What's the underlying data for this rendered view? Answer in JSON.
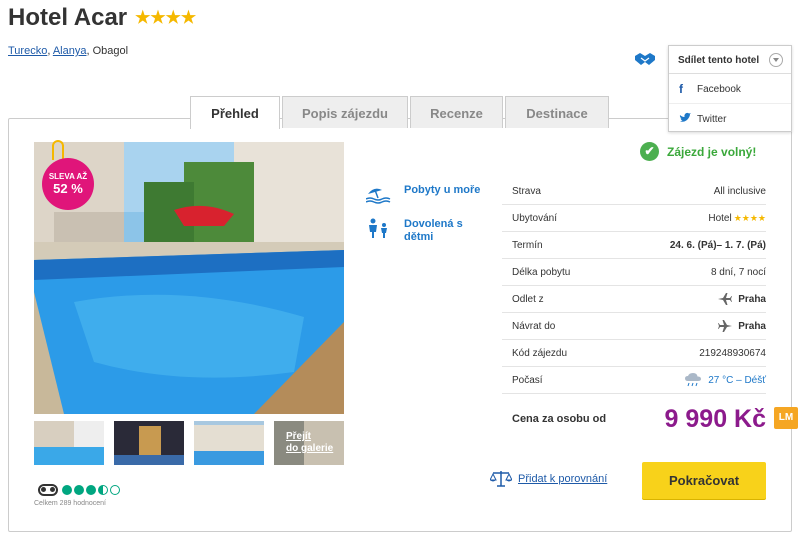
{
  "hotel": {
    "name": "Hotel Acar",
    "stars": "★★★★"
  },
  "breadcrumb": {
    "country": "Turecko",
    "region": "Alanya",
    "city": "Obagol",
    "sep": ", "
  },
  "share": {
    "title": "Sdílet tento hotel",
    "facebook": "Facebook",
    "twitter": "Twitter"
  },
  "tabs": [
    "Přehled",
    "Popis zájezdu",
    "Recenze",
    "Destinace"
  ],
  "sale": {
    "line1": "SLEVA AŽ",
    "line2": "52 %"
  },
  "gallery": {
    "more_line1": "Přejít",
    "more_line2": "do galerie"
  },
  "tripadvisor": {
    "rating": 3.5,
    "count_text": "Celkem 289 hodnocení"
  },
  "features": [
    {
      "icon": "beach-icon",
      "label": "Pobyty u moře"
    },
    {
      "icon": "family-icon",
      "label": "Dovolená s dětmi"
    }
  ],
  "availability": "Zájezd je volný!",
  "details": [
    {
      "label": "Strava",
      "value": "All inclusive"
    },
    {
      "label": "Ubytování",
      "value": "Hotel",
      "stars": "★★★★"
    },
    {
      "label": "Termín",
      "value": "24. 6. (Pá)– 1. 7. (Pá)"
    },
    {
      "label": "Délka pobytu",
      "value": "8 dní, 7 nocí"
    },
    {
      "label": "Odlet z",
      "value": "Praha"
    },
    {
      "label": "Návrat do",
      "value": "Praha"
    },
    {
      "label": "Kód zájezdu",
      "value": "219248930674"
    },
    {
      "label": "Počasí",
      "value": "27 °C – Déšť"
    }
  ],
  "price": {
    "label": "Cena za osobu od",
    "value": "9 990 Kč",
    "badge": "LM"
  },
  "actions": {
    "compare": "Přidat k porovnání",
    "continue": "Pokračovat"
  },
  "colors": {
    "accent": "#1e78c8",
    "price": "#8c1a8c",
    "cta": "#f8d21a",
    "sale": "#e0157a",
    "available": "#3aa83a"
  }
}
